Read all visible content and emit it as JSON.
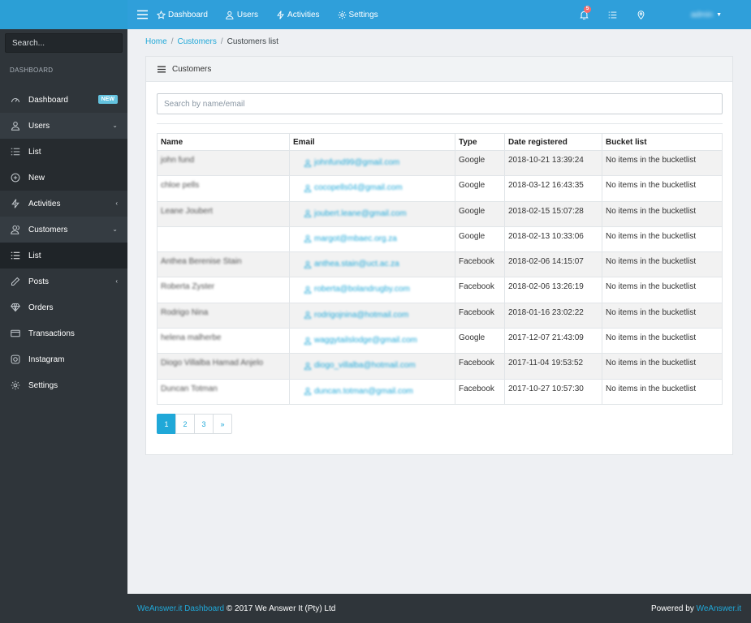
{
  "sidebar": {
    "search_placeholder": "Search...",
    "section_title": "DASHBOARD",
    "dashboard": {
      "label": "Dashboard",
      "badge": "NEW"
    },
    "users": {
      "label": "Users"
    },
    "users_list": {
      "label": "List"
    },
    "users_new": {
      "label": "New"
    },
    "activities": {
      "label": "Activities"
    },
    "customers": {
      "label": "Customers"
    },
    "customers_list": {
      "label": "List"
    },
    "posts": {
      "label": "Posts"
    },
    "orders": {
      "label": "Orders"
    },
    "transactions": {
      "label": "Transactions"
    },
    "instagram": {
      "label": "Instagram"
    },
    "settings": {
      "label": "Settings"
    }
  },
  "header": {
    "nav": {
      "dashboard": "Dashboard",
      "users": "Users",
      "activities": "Activities",
      "settings": "Settings"
    },
    "notifications": "5",
    "user": "admin"
  },
  "breadcrumb": {
    "home": "Home",
    "customers": "Customers",
    "current": "Customers list"
  },
  "card": {
    "title": "Customers",
    "search_placeholder": "Search by name/email",
    "columns": {
      "name": "Name",
      "email": "Email",
      "type": "Type",
      "date": "Date registered",
      "bucket": "Bucket list"
    },
    "rows": [
      {
        "name": "john fund",
        "email": "johnfund99@gmail.com",
        "type": "Google",
        "date": "2018-10-21 13:39:24",
        "bucket": "No items in the bucketlist"
      },
      {
        "name": "chloe pells",
        "email": "cocopells04@gmail.com",
        "type": "Google",
        "date": "2018-03-12 16:43:35",
        "bucket": "No items in the bucketlist"
      },
      {
        "name": "Leane Joubert",
        "email": "joubert.leane@gmail.com",
        "type": "Google",
        "date": "2018-02-15 15:07:28",
        "bucket": "No items in the bucketlist"
      },
      {
        "name": "",
        "email": "margot@mbaec.org.za",
        "type": "Google",
        "date": "2018-02-13 10:33:06",
        "bucket": "No items in the bucketlist"
      },
      {
        "name": "Anthea Berenise Stain",
        "email": "anthea.stain@uct.ac.za",
        "type": "Facebook",
        "date": "2018-02-06 14:15:07",
        "bucket": "No items in the bucketlist"
      },
      {
        "name": "Roberta Zyster",
        "email": "roberta@bolandrugby.com",
        "type": "Facebook",
        "date": "2018-02-06 13:26:19",
        "bucket": "No items in the bucketlist"
      },
      {
        "name": "Rodrigo Nina",
        "email": "rodrigojnina@hotmail.com",
        "type": "Facebook",
        "date": "2018-01-16 23:02:22",
        "bucket": "No items in the bucketlist"
      },
      {
        "name": "helena malherbe",
        "email": "waggytailslodge@gmail.com",
        "type": "Google",
        "date": "2017-12-07 21:43:09",
        "bucket": "No items in the bucketlist"
      },
      {
        "name": "Diogo Villalba Hamad Anjelo",
        "email": "diogo_villalba@hotmail.com",
        "type": "Facebook",
        "date": "2017-11-04 19:53:52",
        "bucket": "No items in the bucketlist"
      },
      {
        "name": "Duncan Totman",
        "email": "duncan.totman@gmail.com",
        "type": "Facebook",
        "date": "2017-10-27 10:57:30",
        "bucket": "No items in the bucketlist"
      }
    ],
    "pages": [
      "1",
      "2",
      "3",
      "»"
    ]
  },
  "footer": {
    "brand_link": "WeAnswer.it Dashboard",
    "copyright": "© 2017 We Answer It (Pty) Ltd",
    "powered_by": "Powered by",
    "powered_link": "WeAnswer.it"
  },
  "colors": {
    "accent": "#20a8d8",
    "header": "#2f9fda",
    "sidebar": "#2f353a",
    "badge_new": "#63c2de",
    "notif": "#f86c6b"
  }
}
